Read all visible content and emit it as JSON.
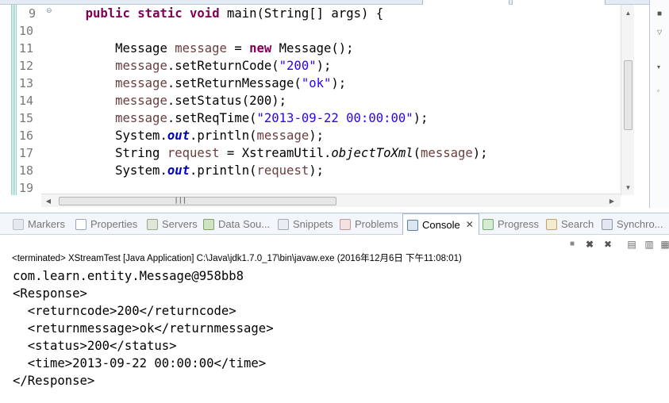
{
  "editor": {
    "line_numbers": [
      "9",
      "10",
      "11",
      "12",
      "13",
      "14",
      "15",
      "16",
      "17",
      "18",
      "19"
    ],
    "code": {
      "l9": [
        "public",
        "static",
        "void",
        "main(String[] args) {"
      ],
      "l11": [
        "Message ",
        "message",
        " = ",
        "new",
        " Message();"
      ],
      "l12": [
        "message",
        ".setReturnCode(",
        "\"200\"",
        ");"
      ],
      "l13": [
        "message",
        ".setReturnMessage(",
        "\"ok\"",
        ");"
      ],
      "l14": [
        "message",
        ".setStatus(200);"
      ],
      "l15": [
        "message",
        ".setReqTime(",
        "\"2013-09-22 00:00:00\"",
        ");"
      ],
      "l16": [
        "System.",
        "out",
        ".println(",
        "message",
        ");"
      ],
      "l17": [
        "String ",
        "request",
        " = XstreamUtil.",
        "objectToXml",
        "(",
        "message",
        ");"
      ],
      "l18": [
        "System.",
        "out",
        ".println(",
        "request",
        ");"
      ]
    }
  },
  "panel": {
    "tabs": [
      {
        "label": "Markers",
        "icon": "markers-icon"
      },
      {
        "label": "Properties",
        "icon": "properties-icon"
      },
      {
        "label": "Servers",
        "icon": "servers-icon"
      },
      {
        "label": "Data Sou...",
        "icon": "data-source-icon"
      },
      {
        "label": "Snippets",
        "icon": "snippets-icon"
      },
      {
        "label": "Problems",
        "icon": "problems-icon"
      },
      {
        "label": "Console",
        "icon": "console-icon",
        "close": "✕"
      },
      {
        "label": "Progress",
        "icon": "progress-icon"
      },
      {
        "label": "Search",
        "icon": "search-icon"
      },
      {
        "label": "Synchro...",
        "icon": "synchronize-icon"
      }
    ],
    "status_line": "<terminated> XStreamTest [Java Application] C:\\Java\\jdk1.7.0_17\\bin\\javaw.exe (2016年12月6日 下午11:08:01)",
    "output_lines": [
      "com.learn.entity.Message@958bb8",
      "<Response>",
      "  <returncode>200</returncode>",
      "  <returnmessage>ok</returnmessage>",
      "  <status>200</status>",
      "  <time>2013-09-22 00:00:00</time>",
      "</Response>"
    ]
  },
  "colors": {
    "keyword": "#7f0055",
    "string": "#2a00ff",
    "local_variable": "#6a3e3e",
    "static_field": "#0000c0",
    "line_number": "#787878"
  }
}
